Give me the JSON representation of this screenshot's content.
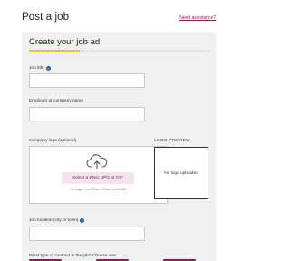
{
  "header": {
    "title": "Post a job",
    "help_link": "Need assistance?"
  },
  "form": {
    "heading": "Create your job ad",
    "job_title": {
      "label": "Job title",
      "value": ""
    },
    "employer": {
      "label": "Employer or company name",
      "value": ""
    },
    "logo": {
      "label": "Company logo (optional)",
      "select_button": "Select a PNG, JPG or GIF",
      "hint": "No bigger than 512px x 512px and 2.5MB",
      "preview_label": "LOGO PREVIEW",
      "preview_empty": "No logo uploaded"
    },
    "location": {
      "label": "Job location (city or town)",
      "value": ""
    },
    "contract_type": {
      "label": "What type of contract is the job? Choose one:"
    }
  },
  "colors": {
    "accent_bar": "#e3c81e",
    "link": "#8a1a5a",
    "info_icon": "#1e56a0",
    "panel_bg": "#f0f0f0"
  },
  "icons": [
    "info-icon",
    "cloud-upload-icon"
  ]
}
